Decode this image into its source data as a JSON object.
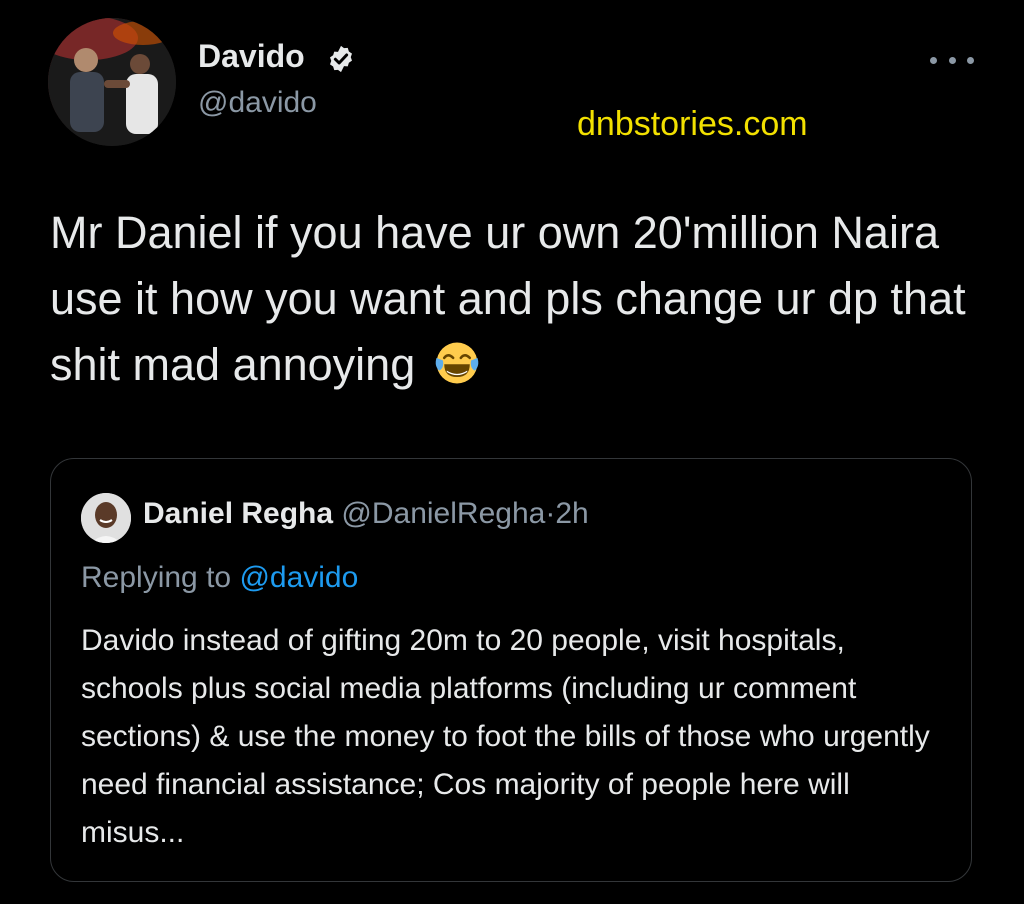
{
  "tweet": {
    "author_name": "Davido",
    "author_handle": "@davido",
    "verified_icon": "verified-badge-icon",
    "more_icon": "more-options-icon",
    "text": "Mr Daniel if you have ur own 20'million Naira use it how you want and pls change ur dp that shit mad annoying",
    "emoji_icon": "face-with-tears-of-joy-icon"
  },
  "watermark": "dnbstories.com",
  "quoted_tweet": {
    "author_name": "Daniel Regha",
    "author_handle": "@DanielRegha",
    "separator": "·",
    "time": "2h",
    "replying_prefix": "Replying to",
    "replying_to": "@davido",
    "text": "Davido instead of gifting 20m to 20 people, visit hospitals, schools plus social media platforms (including ur comment sections) & use the money to foot the bills of those who urgently need financial assistance; Cos majority of people here will misus..."
  },
  "colors": {
    "background": "#000000",
    "text_primary": "#e7e9ea",
    "text_secondary": "#8b98a5",
    "link": "#1d9bf0",
    "watermark": "#f2e000",
    "border": "#333639"
  }
}
